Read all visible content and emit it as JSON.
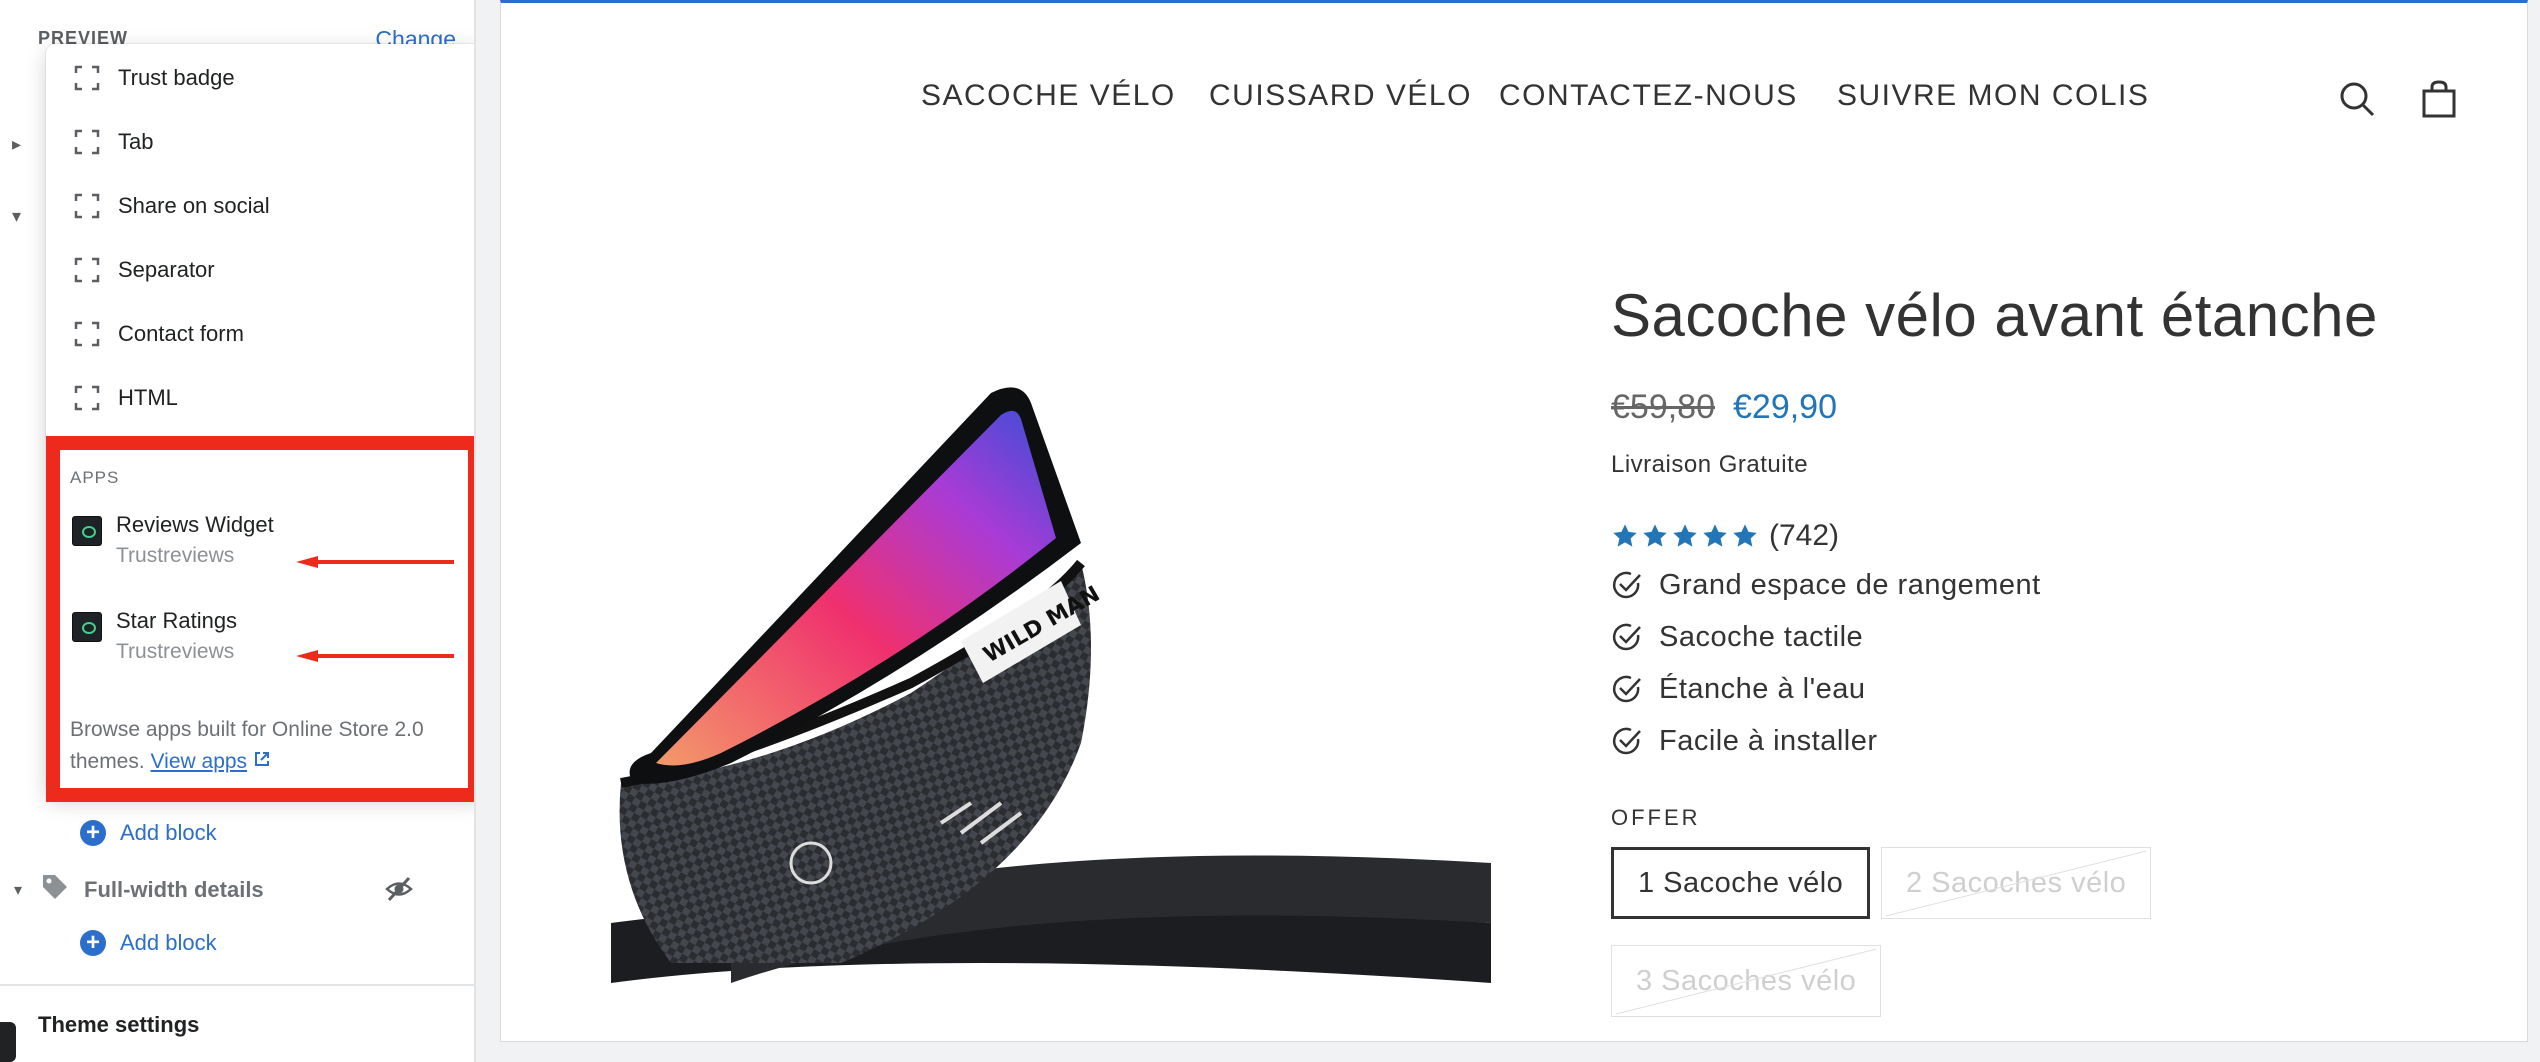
{
  "editor": {
    "preview_label": "PREVIEW",
    "preview_change": "Change",
    "picker": {
      "items": [
        {
          "label": "Trust badge"
        },
        {
          "label": "Tab"
        },
        {
          "label": "Share on social"
        },
        {
          "label": "Separator"
        },
        {
          "label": "Contact form"
        },
        {
          "label": "HTML"
        }
      ],
      "apps_title": "APPS",
      "apps": [
        {
          "name": "Reviews Widget",
          "vendor": "Trustreviews"
        },
        {
          "name": "Star Ratings",
          "vendor": "Trustreviews"
        }
      ],
      "help_text": "Browse apps built for Online Store 2.0 themes.",
      "help_link": "View apps"
    },
    "add_block_label": "Add block",
    "section": {
      "name": "Full-width details"
    },
    "theme_settings": "Theme settings",
    "colors": {
      "accent": "#2c6ecb",
      "highlight": "#ee2a1c"
    }
  },
  "store": {
    "nav": [
      "SACOCHE VÉLO",
      "CUISSARD VÉLO",
      "CONTACTEZ-NOUS",
      "SUIVRE MON COLIS"
    ],
    "product": {
      "title": "Sacoche vélo avant étanche",
      "price_old": "€59,80",
      "price_new": "€29,90",
      "shipping": "Livraison Gratuite",
      "rating": 5,
      "review_count": "(742)",
      "features": [
        "Grand espace de rangement",
        "Sacoche tactile",
        "Étanche à l'eau",
        "Facile à installer"
      ],
      "offer_label": "OFFER",
      "variants": [
        "1 Sacoche vélo",
        "2 Sacoches vélo",
        "3 Sacoches vélo"
      ],
      "photo_brand": "WILD MAN"
    },
    "colors": {
      "price_new": "#2275b7",
      "star": "#2275b7"
    }
  }
}
